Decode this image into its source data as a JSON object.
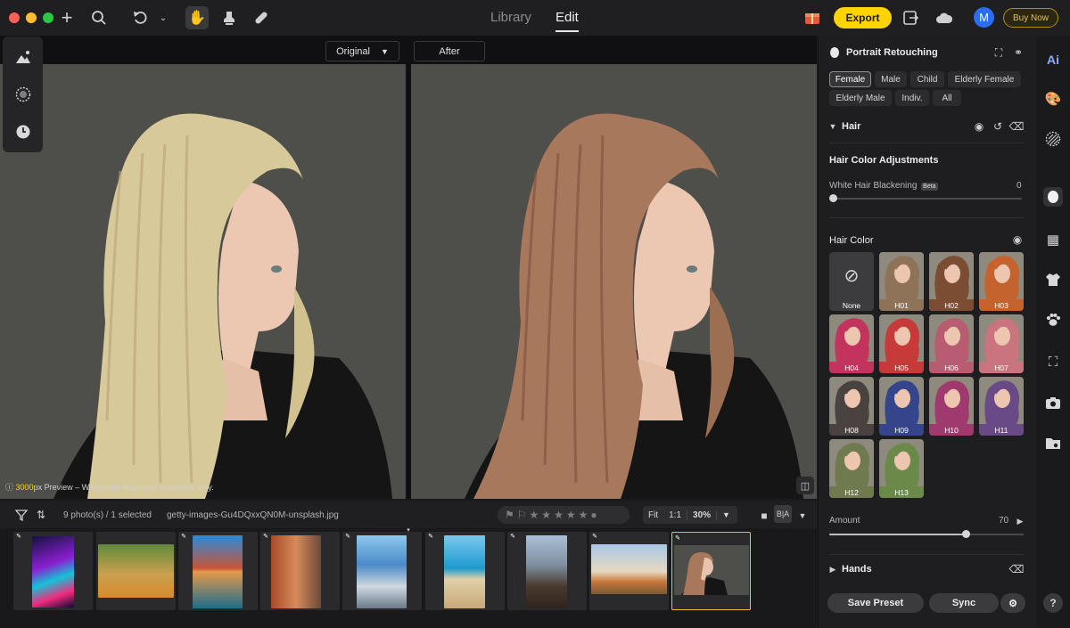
{
  "topbar": {
    "tabs": [
      "Library",
      "Edit"
    ],
    "active_tab": "Edit",
    "export_label": "Export",
    "avatar_initial": "M",
    "buy_now_label": "Buy Now",
    "accent": "#ffd400"
  },
  "canvas": {
    "view_original_label": "Original",
    "view_after_label": "After",
    "preview_size": "3000",
    "preview_note": "px Preview – Watermark displayed in preview only."
  },
  "filmbar": {
    "photo_count": "9 photo(s) / 1 selected",
    "filename": "getty-images-Gu4DQxxQN0M-unsplash.jpg",
    "rating_stars": 5,
    "fit_label": "Fit",
    "one_to_one_label": "1:1",
    "zoom_label": "30%"
  },
  "thumbnails": [
    {
      "name": "neon-sign",
      "selected": false
    },
    {
      "name": "puppies",
      "selected": false
    },
    {
      "name": "castle-reflection",
      "selected": false
    },
    {
      "name": "old-town-street",
      "selected": false
    },
    {
      "name": "city-skyline",
      "selected": false
    },
    {
      "name": "beach",
      "selected": false
    },
    {
      "name": "woman-rocks",
      "selected": false
    },
    {
      "name": "hot-air-balloons",
      "selected": false
    },
    {
      "name": "portrait-woman",
      "selected": true
    }
  ],
  "panel": {
    "title": "Portrait Retouching",
    "subjects": [
      "Female",
      "Male",
      "Child",
      "Elderly Female",
      "Elderly Male",
      "Indiv.",
      "All"
    ],
    "selected_subject": "Female",
    "hair_section": "Hair",
    "hair_color_adjustments": "Hair Color Adjustments",
    "white_hair_label": "White Hair Blackening",
    "white_hair_badge": "Beta",
    "white_hair_value": "0",
    "hair_color_title": "Hair Color",
    "swatches": [
      {
        "label": "None",
        "color": "#4a4a4d"
      },
      {
        "label": "H01",
        "color": "#8f7358"
      },
      {
        "label": "H02",
        "color": "#7b4d33"
      },
      {
        "label": "H03",
        "color": "#c5632f"
      },
      {
        "label": "H04",
        "color": "#c2345d"
      },
      {
        "label": "H05",
        "color": "#c73a3a"
      },
      {
        "label": "H06",
        "color": "#b85c72"
      },
      {
        "label": "H07",
        "color": "#c9747e"
      },
      {
        "label": "H08",
        "color": "#4a4240"
      },
      {
        "label": "H09",
        "color": "#34458c"
      },
      {
        "label": "H10",
        "color": "#a03a6e"
      },
      {
        "label": "H11",
        "color": "#6a4a86"
      },
      {
        "label": "H12",
        "color": "#6f7a4e"
      },
      {
        "label": "H13",
        "color": "#6b8a4a"
      }
    ],
    "selected_swatch": "H02",
    "amount_label": "Amount",
    "amount_value": "70",
    "amount_level": 0.7,
    "hands_section": "Hands",
    "save_preset_label": "Save Preset",
    "sync_label": "Sync"
  },
  "rail": {
    "icons": [
      "ai-icon",
      "palette-icon",
      "texture-icon",
      "portrait-icon",
      "pattern-icon",
      "shirt-icon",
      "paw-icon",
      "crop-icon",
      "camera-icon",
      "folder-eye-icon",
      "help-icon"
    ],
    "ai_label": "Ai",
    "help_label": "?"
  }
}
